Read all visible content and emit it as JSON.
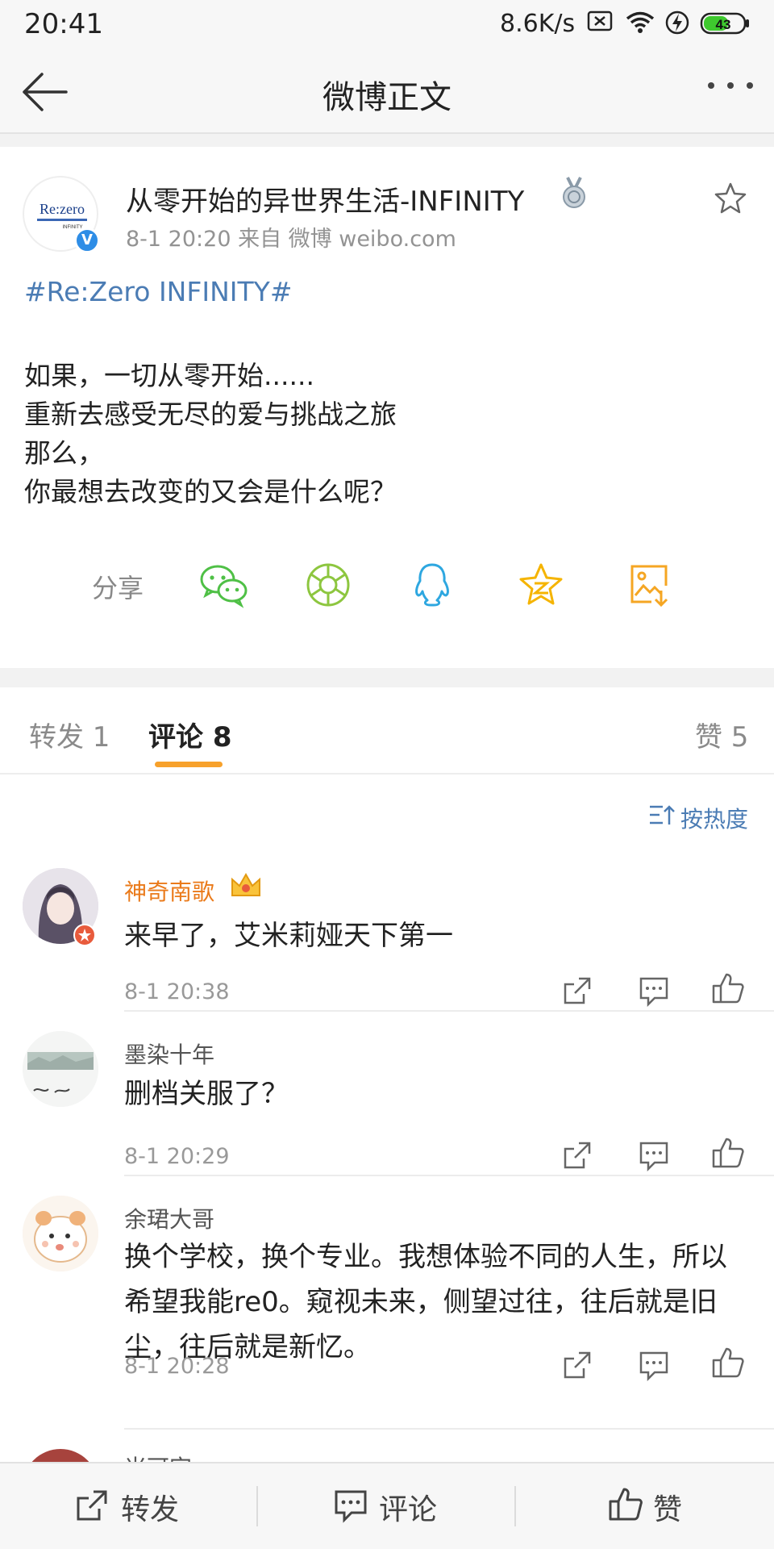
{
  "status": {
    "time": "20:41",
    "speed": "8.6K/s",
    "battery": "43"
  },
  "nav": {
    "title": "微博正文"
  },
  "post": {
    "author": "从零开始的异世界生活-INFINITY",
    "meta": "8-1 20:20   来自 微博 weibo.com",
    "logo_text": "Re:zero",
    "logo_sub": "INFINITY",
    "hashtag": "#Re:Zero INFINITY#",
    "lines": [
      "如果，一切从零开始......",
      "重新去感受无尽的爱与挑战之旅",
      "那么，",
      "你最想去改变的又会是什么呢？"
    ],
    "share_label": "分享"
  },
  "tabs": {
    "repost": "转发 1",
    "comments": "评论 8",
    "likes": "赞 5"
  },
  "sort_label": "按热度",
  "comments": [
    {
      "name": "神奇南歌",
      "text": "来早了，艾米莉娅天下第一",
      "time": "8-1 20:38"
    },
    {
      "name": "墨染十年",
      "text": "删档关服了？",
      "time": "8-1 20:29"
    },
    {
      "name": "余珺大哥",
      "text": "换个学校，换个专业。我想体验不同的人生，所以希望我能re0。窥视未来，侧望过往，往后就是旧尘，往后就是新忆。",
      "time": "8-1 20:28"
    },
    {
      "name": "米可宫"
    }
  ],
  "bottom": {
    "repost": "转发",
    "comment": "评论",
    "like": "赞"
  },
  "colors": {
    "link": "#4b7cb4",
    "accent": "#f7a12b",
    "vip_name": "#ea7a1a"
  }
}
